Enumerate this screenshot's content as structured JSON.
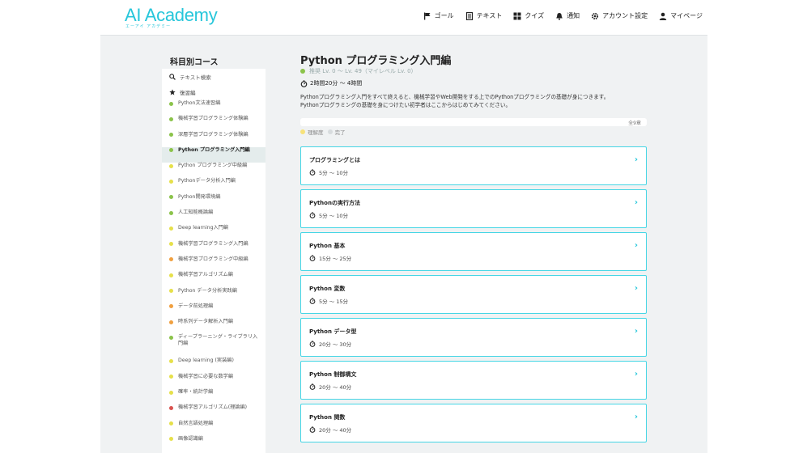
{
  "header": {
    "logo": "AI Academy",
    "logo_sub": "エーアイ アカデミー",
    "nav": [
      {
        "label": "ゴール",
        "icon": "flag-icon"
      },
      {
        "label": "テキスト",
        "icon": "document-icon"
      },
      {
        "label": "クイズ",
        "icon": "grid-icon"
      },
      {
        "label": "通知",
        "icon": "bell-icon"
      },
      {
        "label": "アカウント設定",
        "icon": "gear-icon"
      },
      {
        "label": "マイページ",
        "icon": "user-icon"
      }
    ]
  },
  "sidebar": {
    "title": "科目別コース",
    "search_label": "テキスト検索",
    "review_label": "復習編",
    "items": [
      {
        "label": "Python文法速習編",
        "color": "#8bc34a"
      },
      {
        "label": "機械学習プログラミング体験編",
        "color": "#8bc34a"
      },
      {
        "label": "深層学習プログラミング体験編",
        "color": "#8bc34a"
      },
      {
        "label": "Python プログラミング入門編",
        "color": "#8bc34a",
        "active": true
      },
      {
        "label": "Python プログラミング中級編",
        "color": "#e6e04a"
      },
      {
        "label": "Pythonデータ分析入門編",
        "color": "#e6e04a"
      },
      {
        "label": "Python開発環境編",
        "color": "#8bc34a"
      },
      {
        "label": "人工知能概論編",
        "color": "#8bc34a"
      },
      {
        "label": "Deep learning入門編",
        "color": "#e6e04a"
      },
      {
        "label": "機械学習プログラミング入門編",
        "color": "#e6e04a"
      },
      {
        "label": "機械学習プログラミング中級編",
        "color": "#f0a040"
      },
      {
        "label": "機械学習アルゴリズム編",
        "color": "#e6e04a"
      },
      {
        "label": "Python データ分析実践編",
        "color": "#e6e04a"
      },
      {
        "label": "データ前処理編",
        "color": "#f0a040"
      },
      {
        "label": "時系列データ解析入門編",
        "color": "#f0a040"
      },
      {
        "label": "ディープラーニング・ライブラリ入門編",
        "color": "#8bc34a",
        "tall": true
      },
      {
        "label": "Deep learning (実装編)",
        "color": "#e6e04a"
      },
      {
        "label": "機械学習に必要な数学編",
        "color": "#e6e04a"
      },
      {
        "label": "確率・統計学編",
        "color": "#e6e04a"
      },
      {
        "label": "機械学習アルゴリズム(理論編)",
        "color": "#d9534f"
      },
      {
        "label": "自然言語処理編",
        "color": "#e6e04a"
      },
      {
        "label": "画像認識編",
        "color": "#e6e04a"
      }
    ]
  },
  "main": {
    "title": "Python プログラミング入門編",
    "level": "推奨 Lv. 0 〜 Lv. 49（マイレベル Lv. 0）",
    "time": "2時間20分 〜 4時間",
    "description_1": "Pythonプログラミング入門をすべて終えると、機械学習やWeb開発をする上でのPythonプログラミングの基礎が身につきます。",
    "description_2": "Pythonプログラミングの基礎を身につけたい初学者はここからはじめてみてください。",
    "chapters_total": "全9章",
    "legend_understood": "理解度",
    "legend_done": "完了",
    "legend_understood_color": "#f7e27a",
    "legend_done_color": "#d8dcde",
    "accent": "#26c6da",
    "chapters": [
      {
        "title": "プログラミングとは",
        "time": "5分 〜 10分"
      },
      {
        "title": "Pythonの実行方法",
        "time": "5分 〜 10分"
      },
      {
        "title": "Python 基本",
        "time": "15分 〜 25分"
      },
      {
        "title": "Python 変数",
        "time": "5分 〜 15分"
      },
      {
        "title": "Python データ型",
        "time": "20分 〜 30分"
      },
      {
        "title": "Python 制御構文",
        "time": "20分 〜 40分"
      },
      {
        "title": "Python 関数",
        "time": "20分 〜 40分"
      }
    ]
  }
}
